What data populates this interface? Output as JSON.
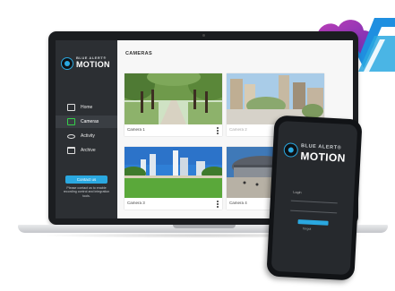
{
  "brand": {
    "name_tag": "BLUE ALERT",
    "name_tm": "®",
    "name_word": "MOTION"
  },
  "sidebar": {
    "items": [
      {
        "label": "Home",
        "icon": "home-icon"
      },
      {
        "label": "Cameras",
        "icon": "camera-icon",
        "active": true
      },
      {
        "label": "Activity",
        "icon": "eye-icon"
      },
      {
        "label": "Archive",
        "icon": "folder-icon"
      }
    ],
    "contact_label": "Contact us",
    "note": "Please contact us to enable recording control and integration tools."
  },
  "main": {
    "title": "CAMERAS",
    "cameras": [
      {
        "name": "Camera 1"
      },
      {
        "name": "Camera 2"
      },
      {
        "name": "Camera 3"
      },
      {
        "name": "Camera 4"
      }
    ]
  },
  "phone": {
    "login_label": "Login",
    "link_label": "forgot"
  },
  "colors": {
    "accent": "#2aa8e0",
    "sidebar": "#2c2f33",
    "active_icon": "#35d04a"
  }
}
